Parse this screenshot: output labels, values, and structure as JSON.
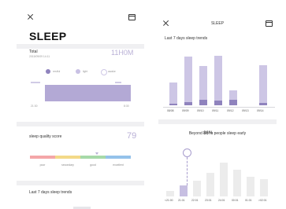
{
  "colors": {
    "accent": "#a79ccd",
    "accent_dark": "#8f83bd",
    "grey_bar": "#ececec",
    "score_text": "#b9b0d6",
    "poor": "#f4a6a8",
    "secondary": "#f3d988",
    "good": "#a6d9a8",
    "excellent": "#94c2ea"
  },
  "left": {
    "title": "SLEEP",
    "total": {
      "label": "Total",
      "subtitle": "2015/09/09 14:11",
      "value": "11H0M"
    },
    "legend": [
      "restful",
      "light",
      "awake"
    ],
    "timeline": {
      "start": "21:30",
      "end": "8:30"
    },
    "quality": {
      "label": "sleep quality score",
      "value": "79",
      "categories": [
        "poor",
        "secondary",
        "good",
        "excellent"
      ]
    },
    "trends_label": "Last 7 days sleep trends"
  },
  "right": {
    "title": "SLEEP",
    "trends_label": "Last 7 days sleep trends",
    "trend_chart": {
      "dates": [
        "08/08",
        "09/09",
        "09/10",
        "09/11",
        "09/12",
        "09/13",
        "09/14"
      ],
      "total": [
        0.47,
        1.0,
        0.8,
        1.02,
        0.3,
        0,
        0.82
      ],
      "deep": [
        0.04,
        0.07,
        0.12,
        0.09,
        0.11,
        0,
        0.05
      ]
    },
    "beyond": {
      "prefix": "Beyond ",
      "percent": "86%",
      "suffix": " people sleep early"
    },
    "time_chart": {
      "labels": [
        "<21:00",
        "21:01",
        "22:01",
        "23:01",
        "24:01",
        "00:01",
        "01:01",
        ">02:01"
      ],
      "values": [
        0.12,
        0.22,
        0.33,
        0.48,
        0.7,
        0.55,
        0.4,
        0.35
      ],
      "highlight_index": 1
    }
  }
}
